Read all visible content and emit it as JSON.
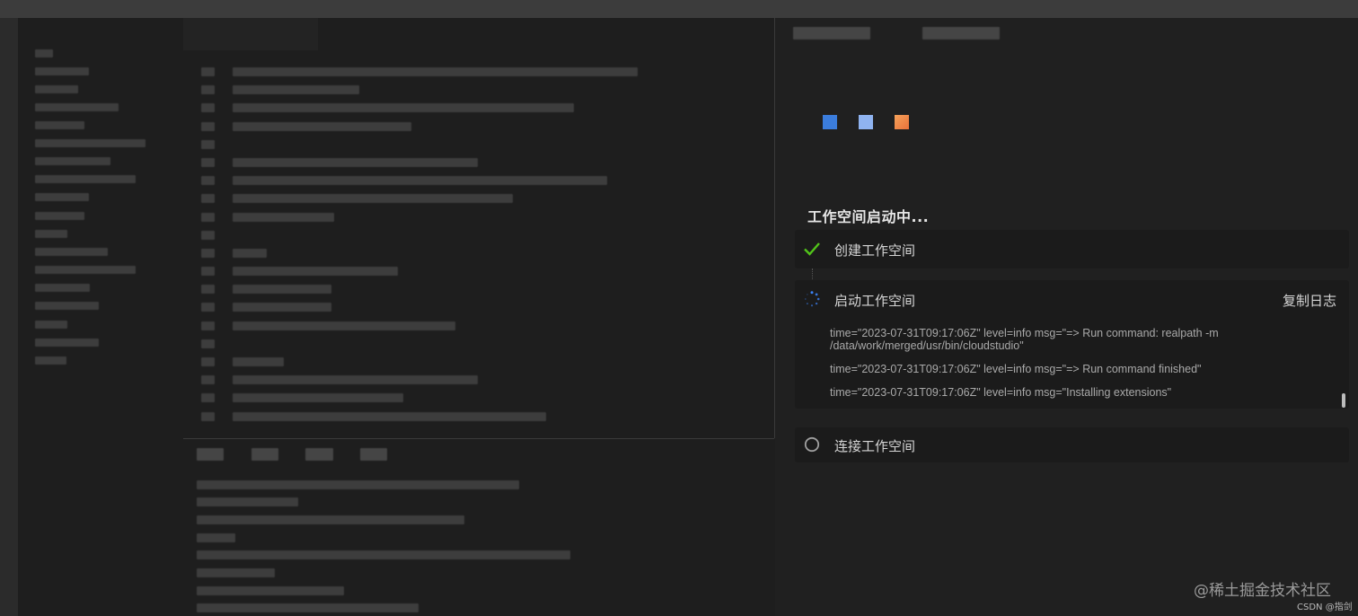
{
  "workspace": {
    "title": "工作空间启动中...",
    "steps": [
      {
        "label": "创建工作空间",
        "status": "done"
      },
      {
        "label": "启动工作空间",
        "status": "in-progress",
        "action_label": "复制日志",
        "logs": [
          "time=\"2023-07-31T09:17:06Z\" level=info msg=\"=> Run command: realpath -m /data/work/merged/usr/bin/cloudstudio\"",
          "time=\"2023-07-31T09:17:06Z\" level=info msg=\"=> Run command finished\"",
          "time=\"2023-07-31T09:17:06Z\" level=info msg=\"Installing extensions\""
        ]
      },
      {
        "label": "连接工作空间",
        "status": "pending"
      }
    ]
  },
  "icons": {
    "done": "check-icon",
    "in_progress": "spinner-icon",
    "pending": "circle-icon"
  },
  "colors": {
    "success": "#52c41a",
    "spinner": "#3b82f6",
    "logo_blue": "#3b7ddd",
    "logo_lightblue": "#8fb3f0",
    "logo_orange": "#f08a3c"
  },
  "watermark": {
    "primary": "@稀土掘金技术社区",
    "secondary": "CSDN @指剑"
  }
}
